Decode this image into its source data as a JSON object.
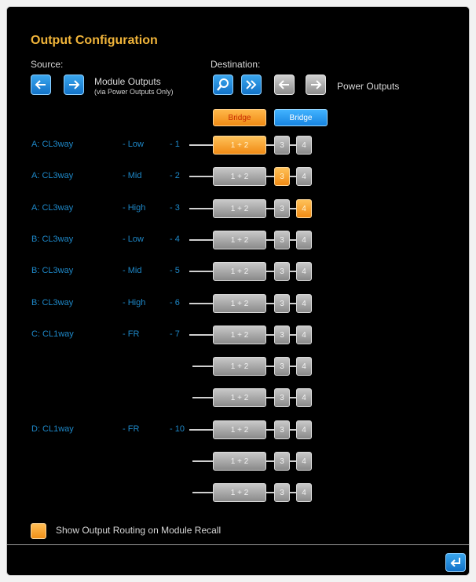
{
  "title": "Output Configuration",
  "source": {
    "label": "Source:",
    "module_outputs": "Module Outputs",
    "module_note": "(via Power Outputs Only)"
  },
  "destination": {
    "label": "Destination:",
    "power_outputs": "Power Outputs"
  },
  "bridge": {
    "left": "Bridge",
    "right": "Bridge"
  },
  "box_labels": {
    "b12": "1 + 2",
    "b3": "3",
    "b4": "4"
  },
  "rows": [
    {
      "module": "A: CL3way",
      "band": "- Low",
      "num": "- 1",
      "active": "b12"
    },
    {
      "module": "A: CL3way",
      "band": "- Mid",
      "num": "- 2",
      "active": "b3"
    },
    {
      "module": "A: CL3way",
      "band": "- High",
      "num": "- 3",
      "active": "b4"
    },
    {
      "module": "B: CL3way",
      "band": "- Low",
      "num": "- 4",
      "active": ""
    },
    {
      "module": "B: CL3way",
      "band": "- Mid",
      "num": "- 5",
      "active": ""
    },
    {
      "module": "B: CL3way",
      "band": "- High",
      "num": "- 6",
      "active": ""
    },
    {
      "module": "C: CL1way",
      "band": "- FR",
      "num": "- 7",
      "active": ""
    },
    {
      "module": "",
      "band": "",
      "num": "",
      "active": ""
    },
    {
      "module": "",
      "band": "",
      "num": "",
      "active": ""
    },
    {
      "module": "D: CL1way",
      "band": "- FR",
      "num": "- 10",
      "active": ""
    },
    {
      "module": "",
      "band": "",
      "num": "",
      "active": ""
    },
    {
      "module": "",
      "band": "",
      "num": "",
      "active": ""
    }
  ],
  "show_routing": {
    "label": "Show Output Routing on Module Recall",
    "checked": true
  },
  "colors": {
    "accent_orange": "#f08a14",
    "accent_blue": "#1784e0",
    "text_blue": "#1e88c8",
    "title": "#f0b43a"
  }
}
